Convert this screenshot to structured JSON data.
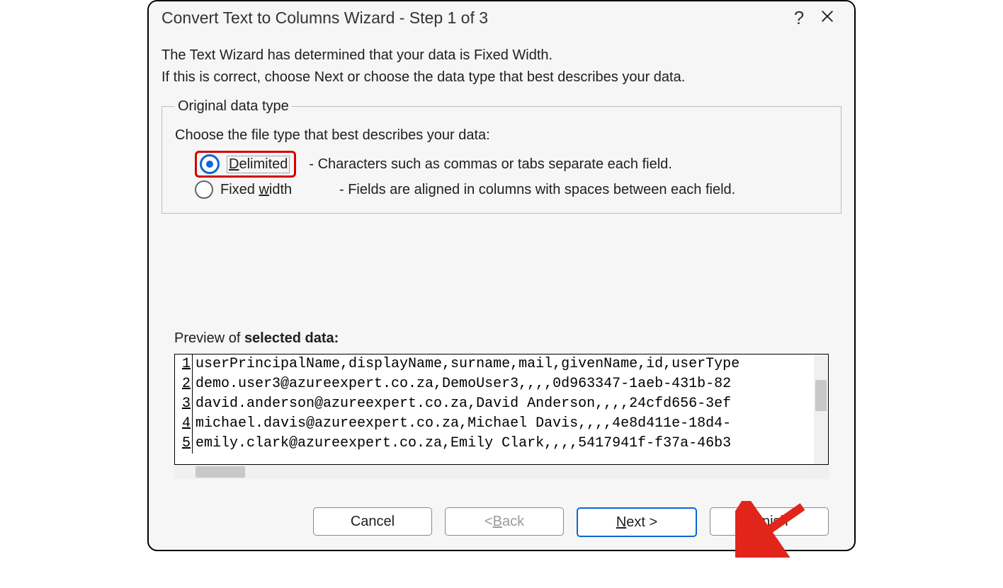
{
  "titlebar": {
    "title": "Convert Text to Columns Wizard - Step 1 of 3"
  },
  "intro": {
    "line1": "The Text Wizard has determined that your data is Fixed Width.",
    "line2": "If this is correct, choose Next or choose the data type that best describes your data."
  },
  "group": {
    "legend": "Original data type",
    "choose": "Choose the file type that best describes your data:",
    "delimited": {
      "prefix": "D",
      "rest": "elimited",
      "desc": "- Characters such as commas or tabs separate each field."
    },
    "fixed": {
      "prefix": "Fixed ",
      "ul": "w",
      "suffix": "idth",
      "desc": "- Fields are aligned in columns with spaces between each field."
    }
  },
  "preview": {
    "label_prefix": "Preview of ",
    "label_bold": "selected data:",
    "rows": [
      {
        "n": "1",
        "t": "userPrincipalName,displayName,surname,mail,givenName,id,userType"
      },
      {
        "n": "2",
        "t": "demo.user3@azureexpert.co.za,DemoUser3,,,,0d963347-1aeb-431b-82"
      },
      {
        "n": "3",
        "t": "david.anderson@azureexpert.co.za,David Anderson,,,,24cfd656-3ef"
      },
      {
        "n": "4",
        "t": "michael.davis@azureexpert.co.za,Michael Davis,,,,4e8d411e-18d4-"
      },
      {
        "n": "5",
        "t": "emily.clark@azureexpert.co.za,Emily Clark,,,,5417941f-f37a-46b3"
      }
    ]
  },
  "buttons": {
    "cancel": "Cancel",
    "back_prefix": "< ",
    "back_ul": "B",
    "back_suffix": "ack",
    "next_ul": "N",
    "next_suffix": "ext >",
    "finish_ul": "F",
    "finish_suffix": "inish"
  }
}
